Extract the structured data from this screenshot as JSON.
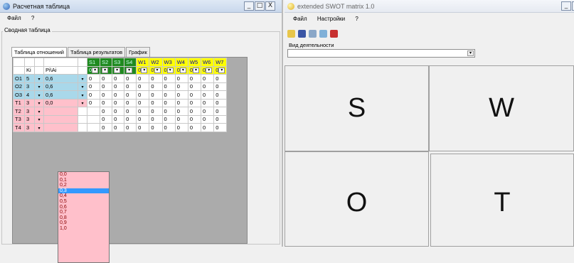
{
  "left_window": {
    "title": "Расчетная таблица",
    "controls": {
      "minimize": "_",
      "maximize": "□",
      "close": "X"
    },
    "menu": [
      "Файл",
      "?"
    ],
    "group_title": "Сводная таблица",
    "tabs": [
      "Таблица отношений",
      "Таблица результатов",
      "График"
    ],
    "grid": {
      "header_top": [
        "",
        "",
        "",
        "",
        "S1",
        "S2",
        "S3",
        "S4",
        "W1",
        "W2",
        "W3",
        "W4",
        "W5",
        "W6",
        "W7"
      ],
      "header_sub": [
        "",
        "Ki",
        "Pi\\Ai",
        "",
        "0",
        "",
        "",
        "",
        "0",
        "0",
        "0",
        "0",
        "0",
        "0",
        "0"
      ],
      "rows": [
        {
          "name": "O1",
          "ki": "5",
          "p": "0,6",
          "vals": [
            "0",
            "0",
            "0",
            "0",
            "0",
            "0",
            "0",
            "0",
            "0",
            "0",
            "0"
          ]
        },
        {
          "name": "O2",
          "ki": "3",
          "p": "0,6",
          "vals": [
            "0",
            "0",
            "0",
            "0",
            "0",
            "0",
            "0",
            "0",
            "0",
            "0",
            "0"
          ]
        },
        {
          "name": "O3",
          "ki": "4",
          "p": "0,6",
          "vals": [
            "0",
            "0",
            "0",
            "0",
            "0",
            "0",
            "0",
            "0",
            "0",
            "0",
            "0"
          ]
        },
        {
          "name": "T1",
          "ki": "3",
          "p": "0,0",
          "vals": [
            "0",
            "0",
            "0",
            "0",
            "0",
            "0",
            "0",
            "0",
            "0",
            "0",
            "0"
          ]
        },
        {
          "name": "T2",
          "ki": "3",
          "p": "",
          "vals": [
            "",
            "0",
            "0",
            "0",
            "0",
            "0",
            "0",
            "0",
            "0",
            "0",
            "0"
          ]
        },
        {
          "name": "T3",
          "ki": "3",
          "p": "",
          "vals": [
            "",
            "0",
            "0",
            "0",
            "0",
            "0",
            "0",
            "0",
            "0",
            "0",
            "0"
          ]
        },
        {
          "name": "T4",
          "ki": "3",
          "p": "",
          "vals": [
            "",
            "0",
            "0",
            "0",
            "0",
            "0",
            "0",
            "0",
            "0",
            "0",
            "0"
          ]
        }
      ]
    },
    "dropdown_options": [
      "0,0",
      "0,1",
      "0,2",
      "0,3",
      "0,4",
      "0,5",
      "0,6",
      "0,7",
      "0,8",
      "0,9",
      "1,0"
    ],
    "dropdown_selected_index": 3
  },
  "right_window": {
    "title": "extended SWOT matrix 1.0",
    "controls": {
      "minimize": "_",
      "maximize": "□",
      "close": "X"
    },
    "menu": [
      "Файл",
      "Настройки",
      "?"
    ],
    "activity_label": "Вид деятельности",
    "activity_value": "",
    "quadrants": [
      "S",
      "W",
      "O",
      "T"
    ]
  },
  "colors": {
    "green": "#1f8a1f",
    "yellow": "#ffff00",
    "blue": "#a9d8ea",
    "pink": "#ffc0cb",
    "selection": "#3399ff"
  }
}
